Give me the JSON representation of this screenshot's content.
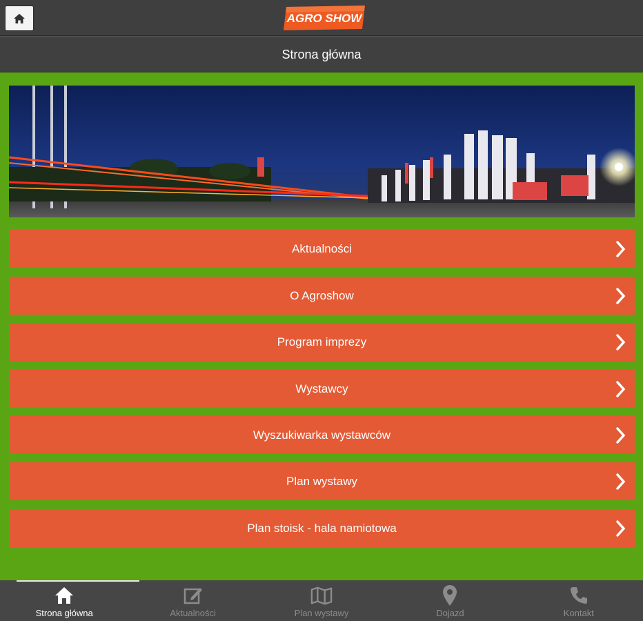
{
  "app": {
    "logo_text": "AGRO SHOW",
    "page_title": "Strona główna"
  },
  "menu": [
    {
      "label": "Aktualności"
    },
    {
      "label": "O Agroshow"
    },
    {
      "label": "Program imprezy"
    },
    {
      "label": "Wystawcy"
    },
    {
      "label": "Wyszukiwarka wystawców"
    },
    {
      "label": "Plan wystawy"
    },
    {
      "label": "Plan stoisk - hala namiotowa"
    }
  ],
  "tabs": [
    {
      "label": "Strona główna",
      "icon": "home-icon",
      "active": true
    },
    {
      "label": "Aktualności",
      "icon": "edit-icon",
      "active": false
    },
    {
      "label": "Plan wystawy",
      "icon": "map-icon",
      "active": false
    },
    {
      "label": "Dojazd",
      "icon": "map-pin-icon",
      "active": false
    },
    {
      "label": "Kontakt",
      "icon": "phone-icon",
      "active": false
    }
  ],
  "colors": {
    "topbar": "#3f3f3f",
    "background_green": "#5aa514",
    "menu_orange": "#e35a35",
    "tabbar": "#464646",
    "logo_orange": "#ee5a22"
  }
}
